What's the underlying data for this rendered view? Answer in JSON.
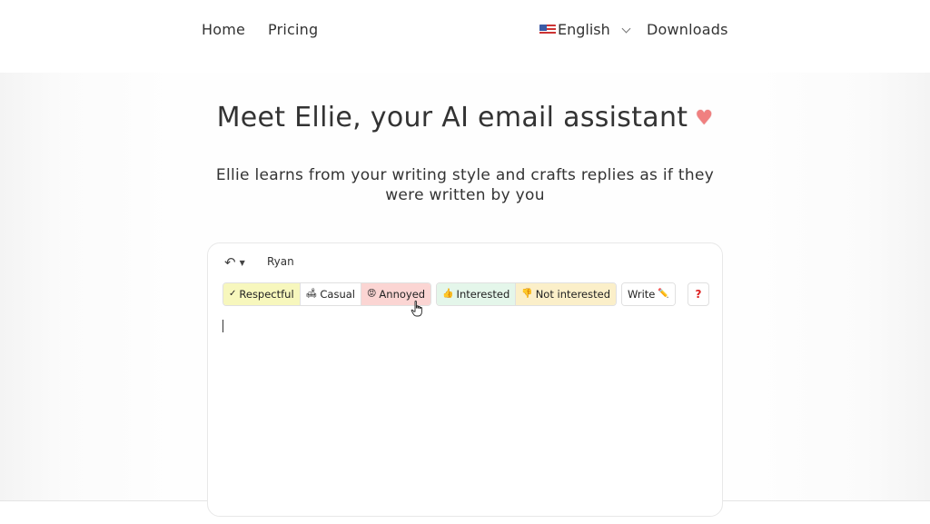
{
  "nav": {
    "home": "Home",
    "pricing": "Pricing",
    "language": "English",
    "downloads": "Downloads"
  },
  "hero": {
    "title": "Meet Ellie, your AI email assistant",
    "heart": "♥",
    "subtitle": "Ellie learns from your writing style and crafts replies as if they were written by you"
  },
  "composer": {
    "recipient": "Ryan",
    "tones": [
      {
        "label": "Respectful",
        "icon": "✓"
      },
      {
        "label": "Casual",
        "icon": "🛋"
      },
      {
        "label": "Annoyed",
        "icon": "😡"
      }
    ],
    "intents": [
      {
        "label": "Interested",
        "icon": "👍"
      },
      {
        "label": "Not interested",
        "icon": "👎"
      }
    ],
    "write": {
      "label": "Write",
      "icon": "✏️"
    },
    "help": "?",
    "body_text": ""
  }
}
